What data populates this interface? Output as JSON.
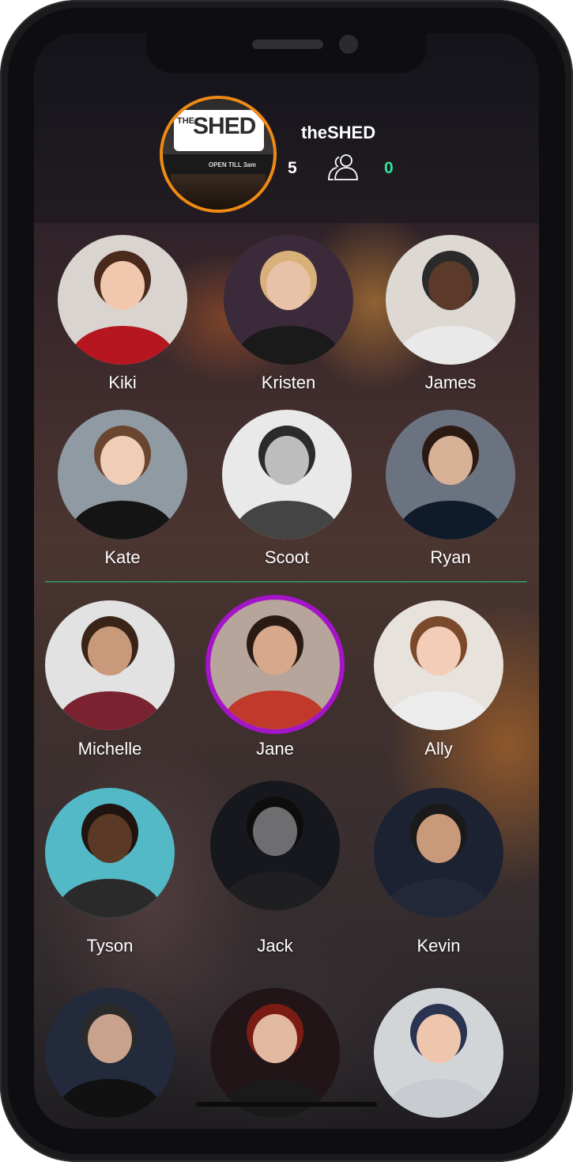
{
  "venue": {
    "name": "theSHED",
    "logo_the": "THE",
    "logo_shed": "SHED",
    "logo_tagline": "OPEN TILL 3am",
    "count_left": "5",
    "count_right": "0"
  },
  "colors": {
    "venue_ring": "#f08a14",
    "highlight_ring": "#a414c8",
    "divider": "#2fc28c",
    "count_right": "#2fe39a"
  },
  "checked_in": [
    {
      "name": "Kiki"
    },
    {
      "name": "Kristen"
    },
    {
      "name": "James"
    },
    {
      "name": "Kate"
    },
    {
      "name": "Scoot"
    },
    {
      "name": "Ryan"
    }
  ],
  "nearby": [
    {
      "name": "Michelle"
    },
    {
      "name": "Jane",
      "highlighted": true
    },
    {
      "name": "Ally"
    },
    {
      "name": "Tyson"
    },
    {
      "name": "Jack"
    },
    {
      "name": "Kevin"
    },
    {
      "name": ""
    },
    {
      "name": ""
    },
    {
      "name": ""
    }
  ],
  "icons": {
    "group": "users-icon"
  }
}
